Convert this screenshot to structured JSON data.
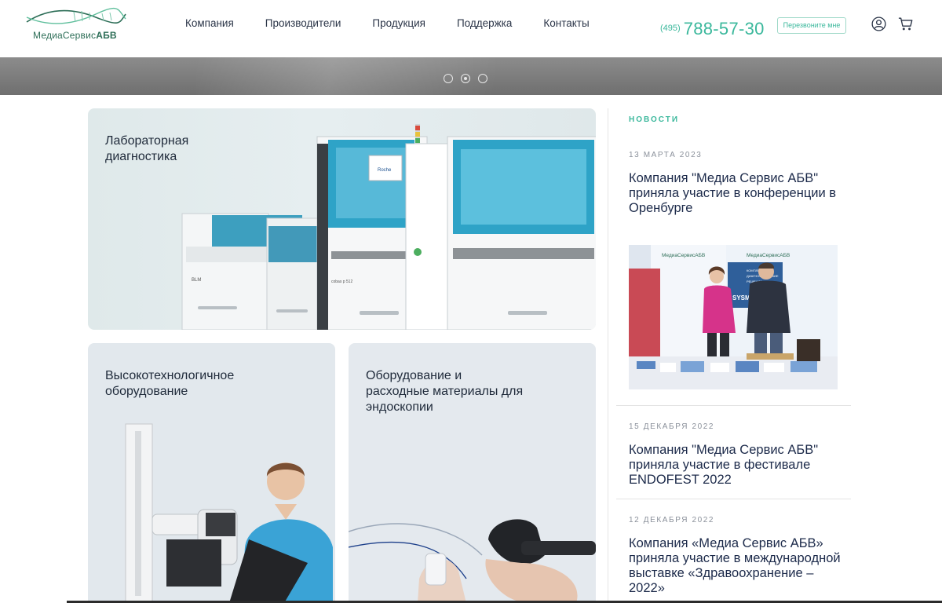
{
  "logo": {
    "brand_part1": "Медиа",
    "brand_part2": "Сервис",
    "brand_part3": "АБВ",
    "color": "#2d6e57"
  },
  "nav": {
    "items": [
      "Компания",
      "Производители",
      "Продукция",
      "Поддержка",
      "Контакты"
    ]
  },
  "header": {
    "phone_code": "(495)",
    "phone_number": "788-57-30",
    "callback_label": "Перезвоните мне",
    "accent_color": "#3bb89c",
    "user_icon": "user-icon",
    "cart_icon": "cart-icon"
  },
  "slider": {
    "dot_count": 3,
    "active_index": 1
  },
  "cards": [
    {
      "title": "Лабораторная\nдиагностика"
    },
    {
      "title": "Высокотехнологичное\nоборудование"
    },
    {
      "title": "Оборудование и\nрасходные материалы для\nэндоскопии"
    }
  ],
  "news": {
    "label": "НОВОСТИ",
    "items": [
      {
        "date": "13 МАРТА 2023",
        "title": "Компания \"Медиа Сервис АБВ\" приняла участие в конференции в Оренбурге"
      },
      {
        "date": "15 ДЕКАБРЯ 2022",
        "title": "Компания \"Медиа Сервис АБВ\" приняла участие в фестивале ENDOFEST 2022"
      },
      {
        "date": "12 ДЕКАБРЯ 2022",
        "title": "Компания «Медиа Сервис АБВ» приняла участие в международной выставке «Здравоохранение – 2022»"
      }
    ]
  },
  "photo_banner": {
    "logo_left": "МедиаСервисАБВ",
    "logo_right": "МедиаСервисАБВ",
    "banner_line1": "КОМПЛЕКСНЫЕ",
    "banner_line2": "ДИАГНОСТИЧЕСКИЕ",
    "banner_line3": "РЕШЕНИЯ",
    "banner_word": "SYSM"
  },
  "devices": {
    "roche_label": "Roche",
    "cobas_label": "cobas p 512",
    "blm_label": "BLM"
  }
}
